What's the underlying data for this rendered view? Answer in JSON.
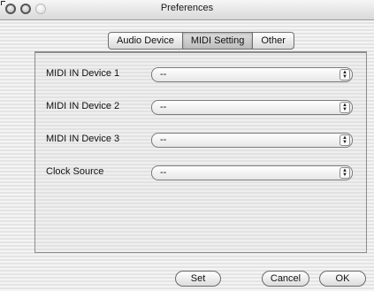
{
  "window": {
    "title": "Preferences"
  },
  "tabs": [
    {
      "label": "Audio Device",
      "selected": false
    },
    {
      "label": "MIDI Setting",
      "selected": true
    },
    {
      "label": "Other",
      "selected": false
    }
  ],
  "settings": [
    {
      "label": "MIDI IN Device 1",
      "value": "--"
    },
    {
      "label": "MIDI IN Device 2",
      "value": "--"
    },
    {
      "label": "MIDI IN Device 3",
      "value": "--"
    },
    {
      "label": "Clock Source",
      "value": "--"
    }
  ],
  "buttons": {
    "set": "Set",
    "cancel": "Cancel",
    "ok": "OK"
  },
  "icons": {
    "close": "close-icon",
    "minimize": "minimize-icon",
    "zoom": "zoom-icon",
    "popup_arrows": "up-down-arrows-icon"
  }
}
